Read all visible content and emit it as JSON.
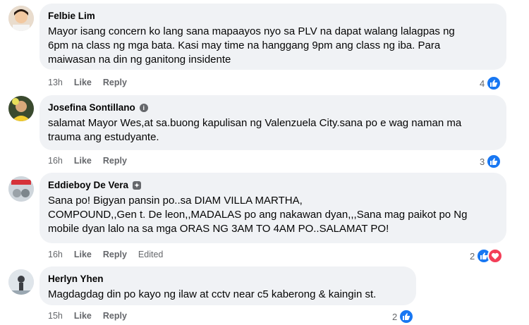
{
  "comments": [
    {
      "author": "Felbie Lim",
      "text": "Mayor isang concern ko lang sana mapaayos nyo sa PLV na dapat walang lalagpas ng\n6pm na class ng mga bata. Kasi may time na hanggang 9pm ang class ng iba. Para\nmaiwasan na din ng ganitong insidente",
      "time": "13h",
      "like": "Like",
      "reply": "Reply",
      "reaction_count": "4"
    },
    {
      "author": "Josefina Sontillano",
      "text": "salamat Mayor Wes,at sa.buong kapulisan ng Valenzuela City.sana po e wag naman ma\ntrauma ang estudyante.",
      "time": "16h",
      "like": "Like",
      "reply": "Reply",
      "reaction_count": "3"
    },
    {
      "author": "Eddieboy De Vera",
      "text": "Sana po! Bigyan pansin po..sa DIAM VILLA MARTHA,\nCOMPOUND,,Gen t. De leon,,MADALAS po ang nakawan dyan,,,Sana mag paikot po Ng\nmobile dyan lalo na sa mga ORAS NG 3AM TO 4AM PO..SALAMAT PO!",
      "time": "16h",
      "like": "Like",
      "reply": "Reply",
      "edited": "Edited",
      "reaction_count": "2"
    },
    {
      "author": "Herlyn Yhen",
      "text": "Magdagdag din po kayo ng ilaw at cctv near c5 kaberong & kaingin st.",
      "time": "15h",
      "like": "Like",
      "reply": "Reply",
      "reaction_count": "2"
    }
  ],
  "colors": {
    "like": "#1877f2",
    "love": "#f33e58",
    "bubble": "#f0f2f5",
    "meta": "#65676b"
  },
  "icons": {
    "like": "thumbs-up-icon",
    "love": "heart-icon",
    "badge": "top-fan-icon"
  }
}
